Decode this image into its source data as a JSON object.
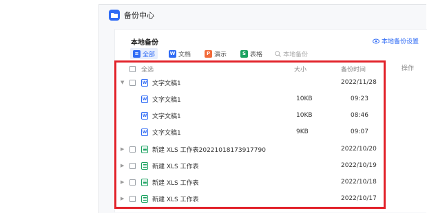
{
  "app": {
    "title": "备份中心"
  },
  "panel": {
    "title": "本地备份",
    "settings_label": "本地备份设置"
  },
  "filters": [
    {
      "label": "全部",
      "icon": "list-icon",
      "color": "#2f6bf5"
    },
    {
      "label": "文档",
      "icon": "word-icon",
      "color": "#2f6bf5"
    },
    {
      "label": "演示",
      "icon": "ppt-icon",
      "color": "#f26b3a"
    },
    {
      "label": "表格",
      "icon": "sheet-icon",
      "color": "#1aa260"
    }
  ],
  "search": {
    "placeholder": "本地备份"
  },
  "table": {
    "headers": {
      "select_all": "全选",
      "size": "大小",
      "time": "备份时间",
      "ops": "操作"
    },
    "rows": [
      {
        "name": "文字文稿1",
        "size": "",
        "time": "2022/11/28",
        "type": "doc",
        "expanded": true,
        "child": false
      },
      {
        "name": "文字文稿1",
        "size": "10KB",
        "time": "09:23",
        "type": "doc",
        "expanded": false,
        "child": true
      },
      {
        "name": "文字文稿1",
        "size": "10KB",
        "time": "08:46",
        "type": "doc",
        "expanded": false,
        "child": true
      },
      {
        "name": "文字文稿1",
        "size": "9KB",
        "time": "09:07",
        "type": "doc",
        "expanded": false,
        "child": true
      },
      {
        "name": "新建 XLS 工作表20221018173917790",
        "size": "",
        "time": "2022/10/20",
        "type": "xls",
        "expanded": false,
        "child": false
      },
      {
        "name": "新建 XLS 工作表",
        "size": "",
        "time": "2022/10/19",
        "type": "xls",
        "expanded": false,
        "child": false
      },
      {
        "name": "新建 XLS 工作表",
        "size": "",
        "time": "2022/10/18",
        "type": "xls",
        "expanded": false,
        "child": false
      },
      {
        "name": "新建 XLS 工作表",
        "size": "",
        "time": "2022/10/17",
        "type": "xls",
        "expanded": false,
        "child": false
      }
    ]
  },
  "colors": {
    "accent": "#2f6bf5",
    "highlight_border": "#e2232b"
  }
}
